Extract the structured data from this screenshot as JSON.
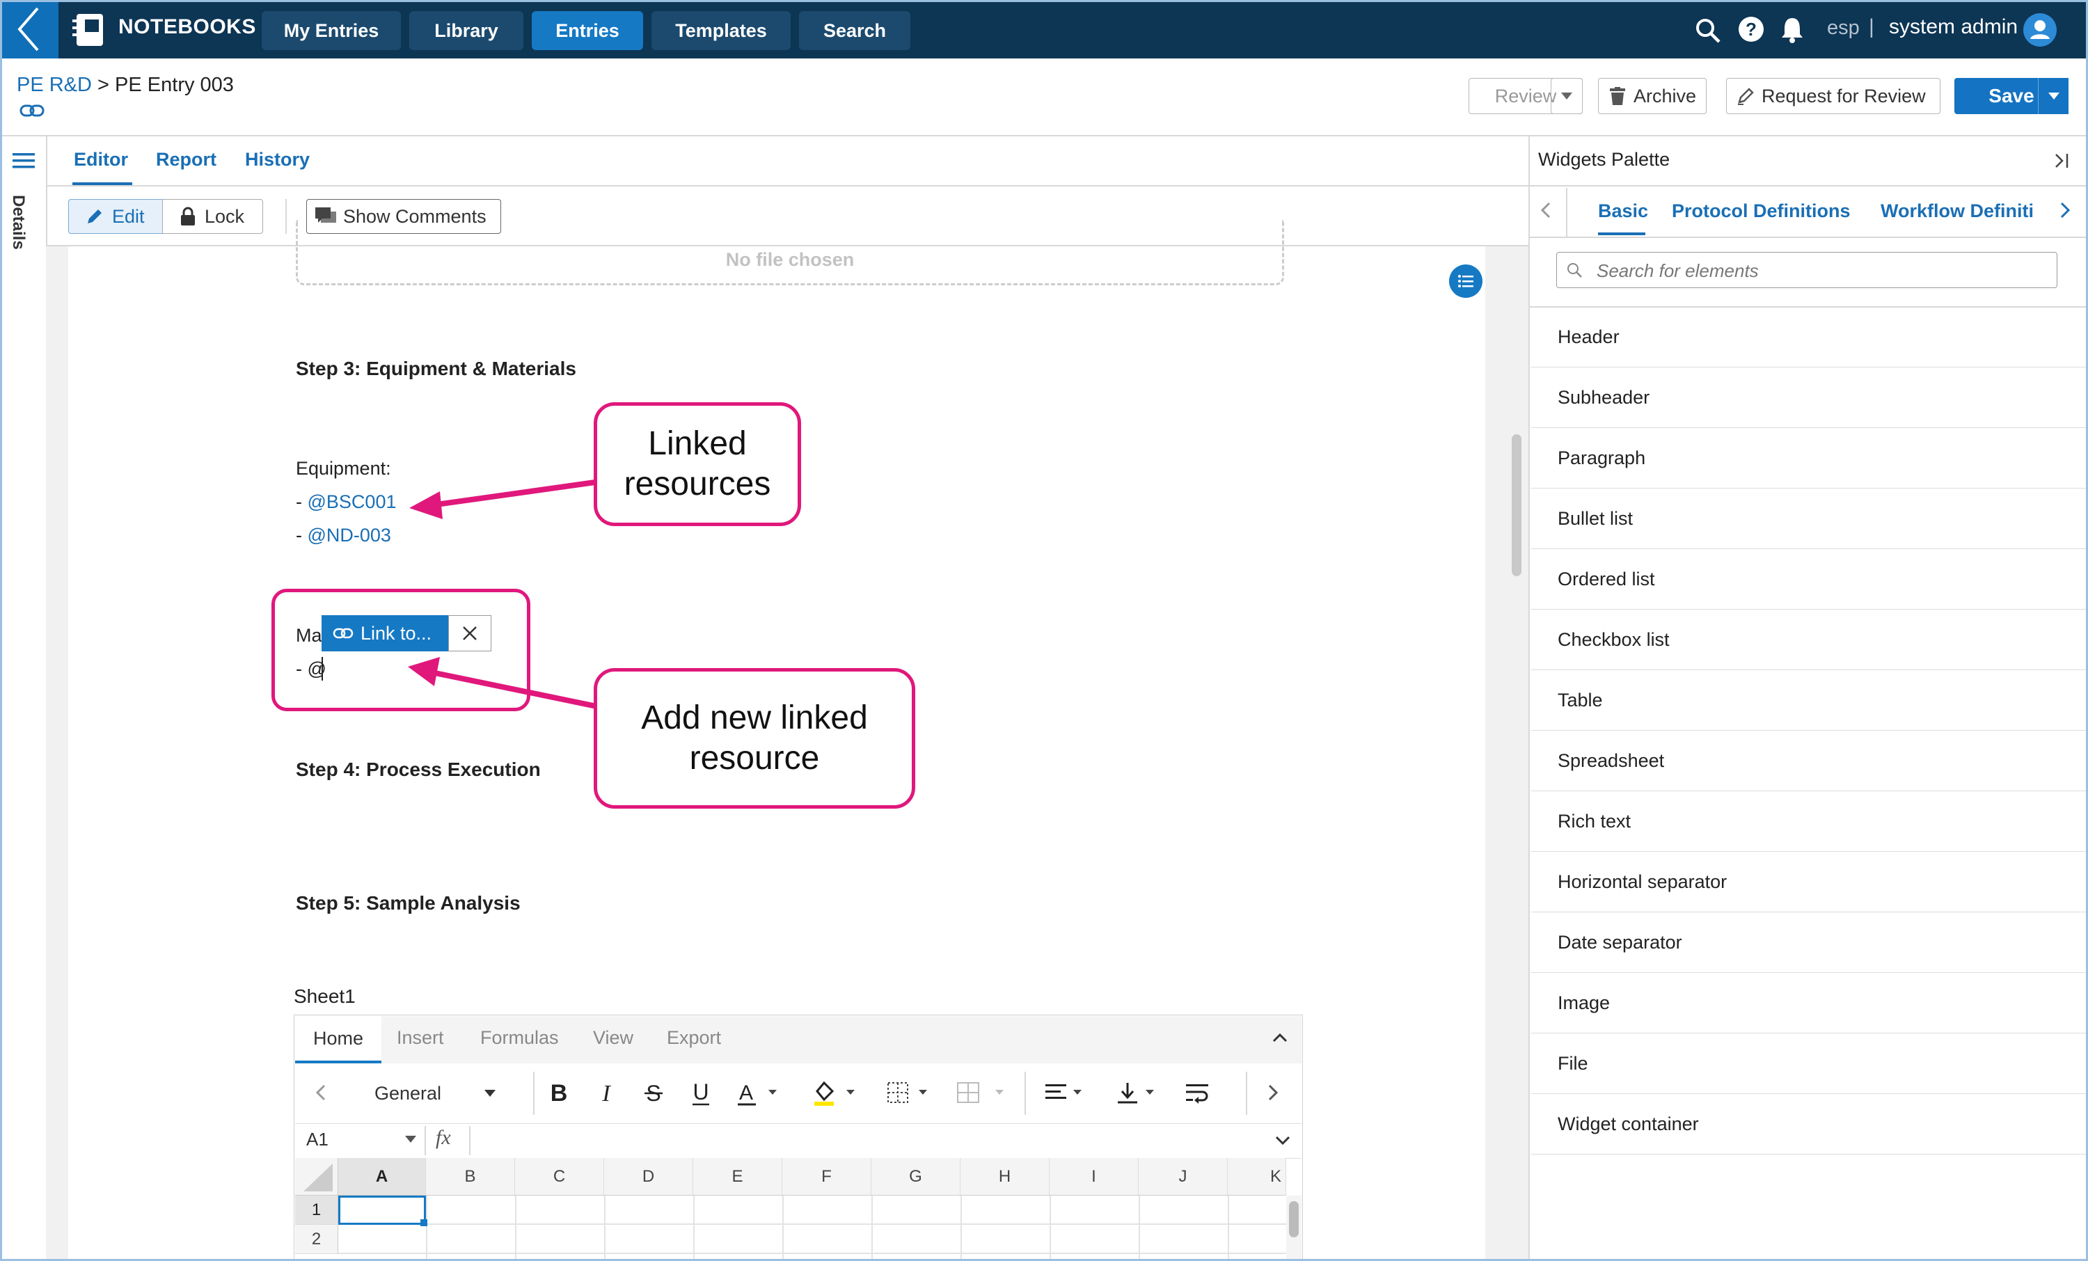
{
  "app": {
    "name": "NOTEBOOKS",
    "nav_tabs": [
      {
        "label": "My Entries"
      },
      {
        "label": "Library"
      },
      {
        "label": "Entries",
        "active": true
      },
      {
        "label": "Templates"
      },
      {
        "label": "Search"
      }
    ],
    "language": "esp",
    "separator": "|",
    "user_name": "system admin"
  },
  "header": {
    "breadcrumb_parent": "PE R&D",
    "breadcrumb_sep": ">",
    "breadcrumb_current": "PE Entry 003",
    "review_label": "Review",
    "archive_label": "Archive",
    "request_review_label": "Request for Review",
    "save_label": "Save"
  },
  "editor": {
    "tabs": [
      {
        "label": "Editor",
        "active": true
      },
      {
        "label": "Report"
      },
      {
        "label": "History"
      }
    ],
    "details_label": "Details",
    "edit_label": "Edit",
    "lock_label": "Lock",
    "show_comments_label": "Show Comments"
  },
  "document": {
    "file_placeholder": "No file chosen",
    "step3_heading": "Step 3: Equipment & Materials",
    "equipment_label": "Equipment:",
    "bullet_prefix": "- ",
    "equipment_links": [
      "@BSC001",
      "@ND-003"
    ],
    "materials_label": "Ma",
    "materials_item": "- @",
    "step4_heading": "Step 4: Process Execution",
    "step5_heading": "Step 5: Sample Analysis",
    "link_popup_label": "Link to..."
  },
  "annotations": {
    "linked_resources": [
      "Linked",
      "resources"
    ],
    "add_new": [
      "Add new linked",
      "resource"
    ],
    "accent_color": "#e0187c"
  },
  "spreadsheet": {
    "sheet_name": "Sheet1",
    "tabs": [
      "Home",
      "Insert",
      "Formulas",
      "View",
      "Export"
    ],
    "number_format": "General",
    "cell_ref": "A1",
    "fx_label": "fx",
    "columns": [
      "A",
      "B",
      "C",
      "D",
      "E",
      "F",
      "G",
      "H",
      "I",
      "J",
      "K"
    ],
    "rows": [
      "1",
      "2"
    ]
  },
  "palette": {
    "title": "Widgets Palette",
    "tabs": [
      "Basic",
      "Protocol Definitions",
      "Workflow Definiti"
    ],
    "search_placeholder": "Search for elements",
    "widgets": [
      "Header",
      "Subheader",
      "Paragraph",
      "Bullet list",
      "Ordered list",
      "Checkbox list",
      "Table",
      "Spreadsheet",
      "Rich text",
      "Horizontal separator",
      "Date separator",
      "Image",
      "File",
      "Widget container"
    ]
  },
  "colors": {
    "nav_bg": "#0d3554",
    "primary": "#1679c4",
    "link": "#1a6fb5"
  }
}
